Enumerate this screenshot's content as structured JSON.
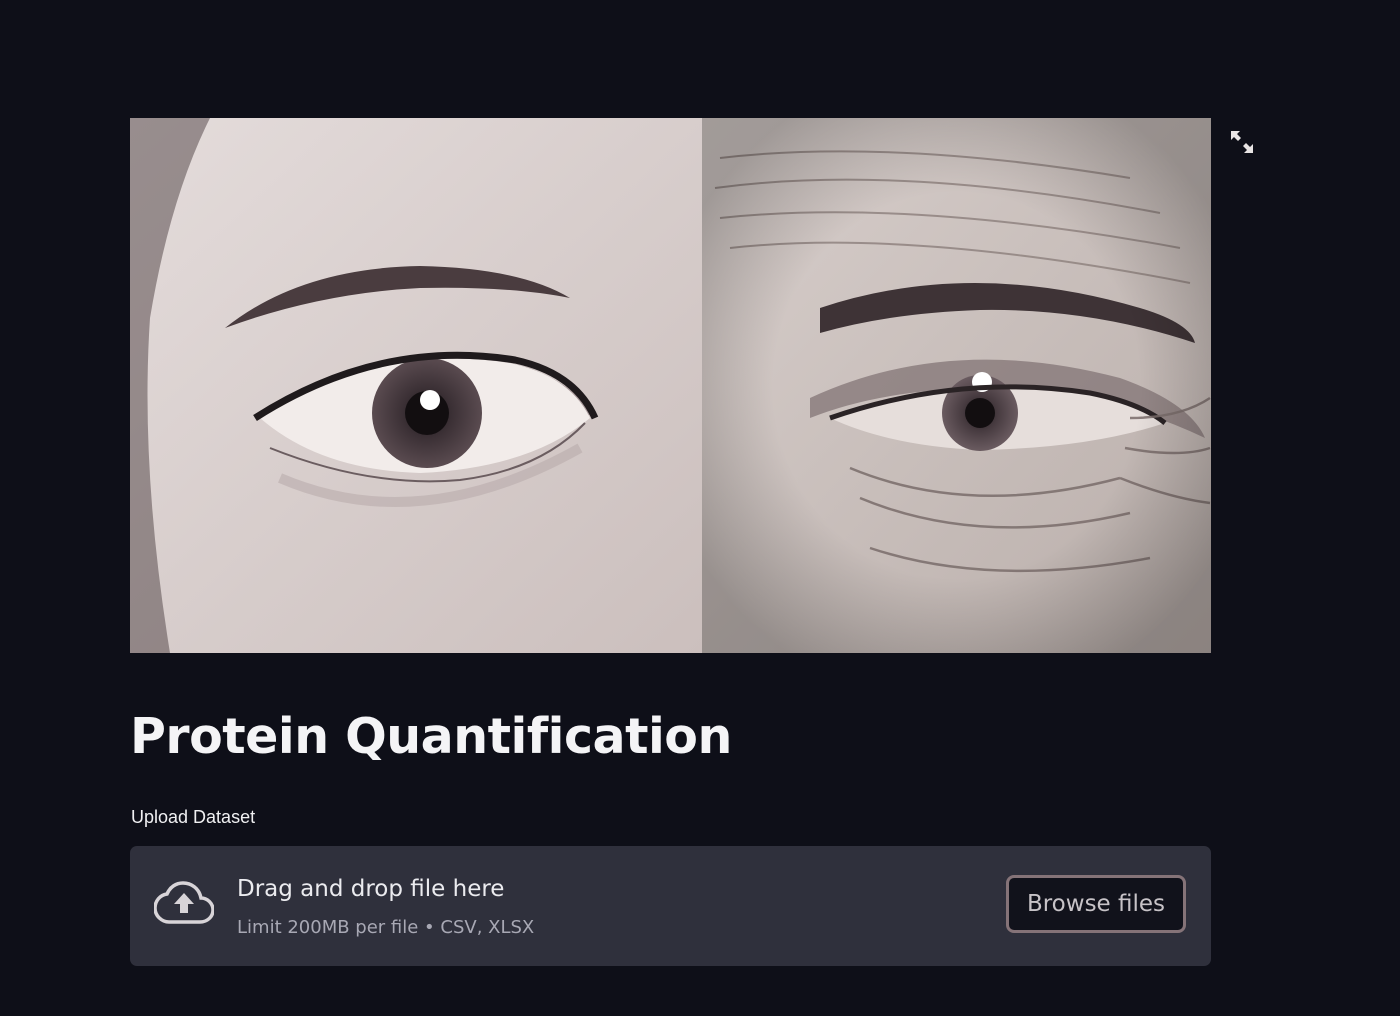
{
  "hero": {
    "alt": "Side-by-side close-up of a young eye and an old eye",
    "fullscreen_icon": "expand-icon"
  },
  "page_title": "Protein Quantification",
  "uploader": {
    "label": "Upload Dataset",
    "dropzone_title": "Drag and drop file here",
    "dropzone_subtitle": "Limit 200MB per file • CSV, XLSX",
    "browse_label": "Browse files",
    "upload_icon": "cloud-upload-icon"
  },
  "colors": {
    "background": "#0e0f18",
    "dropzone_bg": "#2f303c",
    "button_border": "#857378"
  }
}
